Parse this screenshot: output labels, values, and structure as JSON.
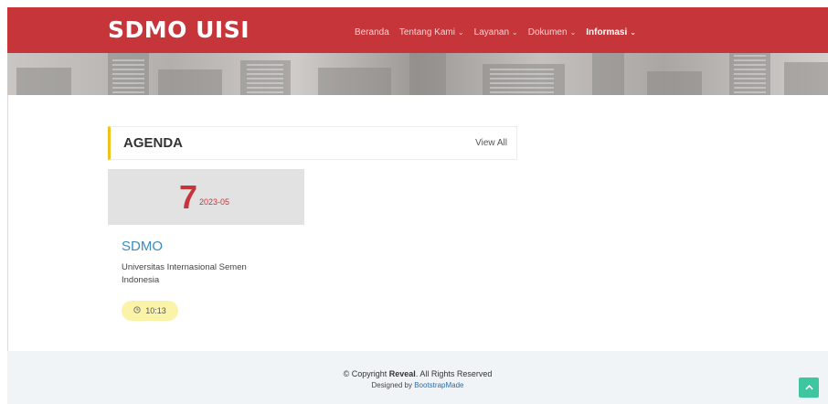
{
  "header": {
    "logo": "SDMO UISI",
    "nav": [
      {
        "label": "Beranda",
        "has_dropdown": false
      },
      {
        "label": "Tentang Kami",
        "has_dropdown": true
      },
      {
        "label": "Layanan",
        "has_dropdown": true
      },
      {
        "label": "Dokumen",
        "has_dropdown": true
      },
      {
        "label": "Informasi",
        "has_dropdown": true,
        "active": true
      }
    ],
    "chevron": "⌄"
  },
  "agenda": {
    "title": "AGENDA",
    "view_all": "View All"
  },
  "event": {
    "day": "7",
    "year_month": "2023-05",
    "title": "SDMO",
    "description": "Universitas Internasional Semen Indonesia",
    "time": "10:13",
    "clock_icon": "clock-icon"
  },
  "footer": {
    "copyright_prefix": "© Copyright ",
    "brand": "Reveal",
    "copyright_suffix": ". All Rights Reserved",
    "designed_by": "Designed by ",
    "designer": "BootstrapMade"
  },
  "colors": {
    "header": "#c6353a",
    "accent_yellow": "#f2c21a",
    "link_blue": "#3b8bbd",
    "back_to_top": "#3ec6a0"
  }
}
